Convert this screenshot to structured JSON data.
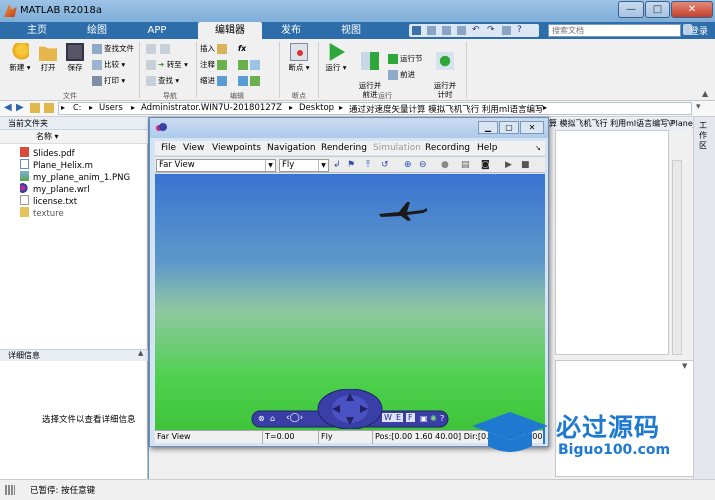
{
  "window": {
    "title": "MATLAB R2018a",
    "minimize": "—",
    "maximize": "□",
    "close": "✕"
  },
  "tabs": [
    {
      "label": "主页"
    },
    {
      "label": "绘图"
    },
    {
      "label": "APP"
    },
    {
      "label": "编辑器"
    },
    {
      "label": "发布"
    },
    {
      "label": "视图"
    }
  ],
  "search": {
    "placeholder": "搜索文档",
    "login": "登录"
  },
  "ribbon": {
    "file": {
      "new": "新建",
      "open": "打开",
      "save": "保存",
      "find_files": "查找文件",
      "compare": "比较",
      "print": "打印",
      "group": "文件"
    },
    "nav": {
      "goto": "转至",
      "find": "查找",
      "group": "导航"
    },
    "edit": {
      "insert": "插入",
      "comment": "注释",
      "indent": "缩进",
      "fx": "fx",
      "group": "编辑"
    },
    "breakpoints": {
      "label": "断点",
      "group": "断点"
    },
    "run": {
      "run": "运行",
      "run_advance": "运行并\n前进",
      "run_section": "运行节",
      "advance": "前进",
      "run_time": "运行并\n计时",
      "group": "运行"
    }
  },
  "address": {
    "path": [
      "C:",
      "Users",
      "Administrator.WIN7U-20180127Z",
      "Desktop",
      "通过对速度矢量计算 模拟飞机飞行 利用ml语言编写"
    ],
    "overflow_path": "算 模拟飞机飞行 利用ml语言编写\\Plane_He..."
  },
  "file_panel": {
    "title": "当前文件夹",
    "column": "名称",
    "files": [
      {
        "name": "Slides.pdf",
        "icon": "pdf-icon"
      },
      {
        "name": "Plane_Helix.m",
        "icon": "m-file-icon"
      },
      {
        "name": "my_plane_anim_1.PNG",
        "icon": "image-icon"
      },
      {
        "name": "my_plane.wrl",
        "icon": "vrml-icon"
      },
      {
        "name": "license.txt",
        "icon": "text-file-icon"
      },
      {
        "name": "texture",
        "icon": "folder-icon"
      }
    ],
    "details_title": "详细信息",
    "details_text": "选择文件以查看详细信息"
  },
  "workspace_strip_label": "工作区",
  "status": {
    "text": "已暂停: 按任意键"
  },
  "vr": {
    "menu": [
      "File",
      "View",
      "Viewpoints",
      "Navigation",
      "Rendering",
      "Simulation",
      "Recording",
      "Help"
    ],
    "viewpoint": "Far View",
    "nav_mode": "Fly",
    "status": {
      "viewpoint": "Far View",
      "time": "T=0.00",
      "mode": "Fly",
      "pos": "Pos:[0.00 1.60 40.00] Dir:[0.00 0.00 -1.00]"
    },
    "nav_labels": {
      "walk": "W",
      "examine": "E",
      "fly": "F",
      "help": "?"
    }
  },
  "watermark": {
    "brand": "必过源码",
    "url": "Biguo100.com"
  },
  "colors": {
    "titlebar": "#9dc3e6",
    "tabrow": "#2d6eaa",
    "sky_top": "#3a73d2",
    "ground": "#4ed14e",
    "nav_panel": "#3a3fa8",
    "watermark_blue": "#1d7ad0"
  }
}
